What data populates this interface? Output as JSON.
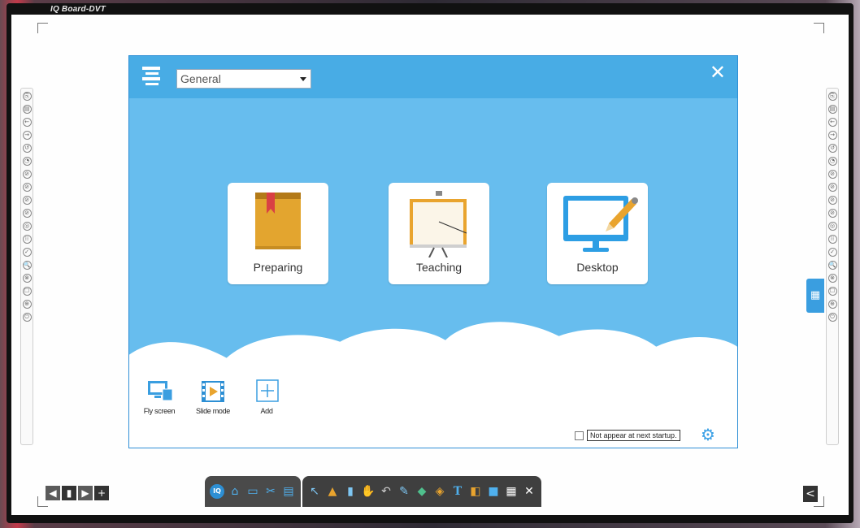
{
  "brand": "IQ Board-DVT",
  "dialog": {
    "category_select": "General",
    "close_symbol": "✕",
    "cards": [
      {
        "label": "Preparing"
      },
      {
        "label": "Teaching"
      },
      {
        "label": "Desktop"
      }
    ],
    "tools": [
      {
        "label": "Fly screen"
      },
      {
        "label": "Slide mode"
      },
      {
        "label": "Add"
      }
    ],
    "startup_checkbox_label": "Not appear at next startup.",
    "startup_checked": false
  },
  "side_buttons": [
    "⎘",
    "▤",
    "←",
    "→",
    "↺",
    "◔",
    "⊘",
    "⊘",
    "⊘",
    "⊘",
    "◎",
    "⁞⁞",
    "✓",
    "🔍",
    "⊗",
    "☐",
    "⊕",
    "⏻"
  ],
  "pager": {
    "prev": "◀",
    "page": "▮",
    "next": "▶",
    "add": "+"
  },
  "toolbar": {
    "group1": [
      "iq-logo-icon",
      "home-icon",
      "screen-icon",
      "scissors-icon",
      "keyboard-icon"
    ],
    "group2": [
      "pointer-icon",
      "pen-icon",
      "eraser-icon",
      "hand-icon",
      "undo-icon",
      "annotate-icon",
      "shape-icon",
      "tag-icon",
      "text-icon",
      "bucket-icon",
      "camera-icon",
      "grid-icon",
      "close-icon"
    ]
  },
  "colors": {
    "accent": "#48ace5",
    "sky": "#67bdee",
    "toolbar": "#4a4a4a"
  }
}
